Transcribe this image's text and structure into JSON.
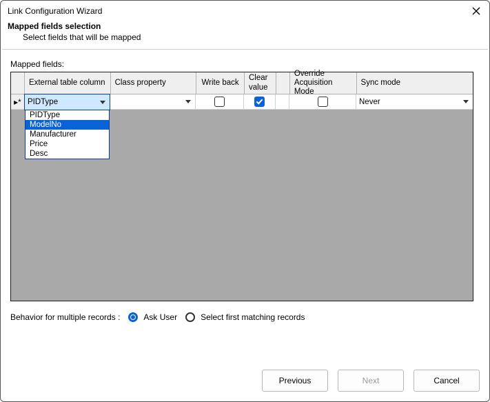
{
  "dialog": {
    "title": "Link Configuration Wizard",
    "header_main": "Mapped fields selection",
    "header_sub": "Select fields that will be mapped"
  },
  "mapped": {
    "section_label": "Mapped fields:",
    "columns": {
      "external": "External table column",
      "class_property": "Class property",
      "write_back": "Write back",
      "clear_value": "Clear value",
      "override": "Override Acquisition Mode",
      "sync_mode": "Sync mode"
    },
    "row_marker": "▸*",
    "row": {
      "external_value": "PIDType",
      "class_property_value": "",
      "write_back_checked": false,
      "clear_value_checked": true,
      "override_checked": false,
      "sync_mode_value": "Never"
    },
    "dropdown": {
      "options": [
        "PIDType",
        "ModelNo",
        "Manufacturer",
        "Price",
        "Desc"
      ],
      "highlighted": "ModelNo"
    }
  },
  "behavior": {
    "label": "Behavior for multiple records :",
    "ask_user": "Ask User",
    "select_first": "Select first matching records",
    "selected": "ask_user"
  },
  "buttons": {
    "previous": "Previous",
    "next": "Next",
    "cancel": "Cancel"
  }
}
